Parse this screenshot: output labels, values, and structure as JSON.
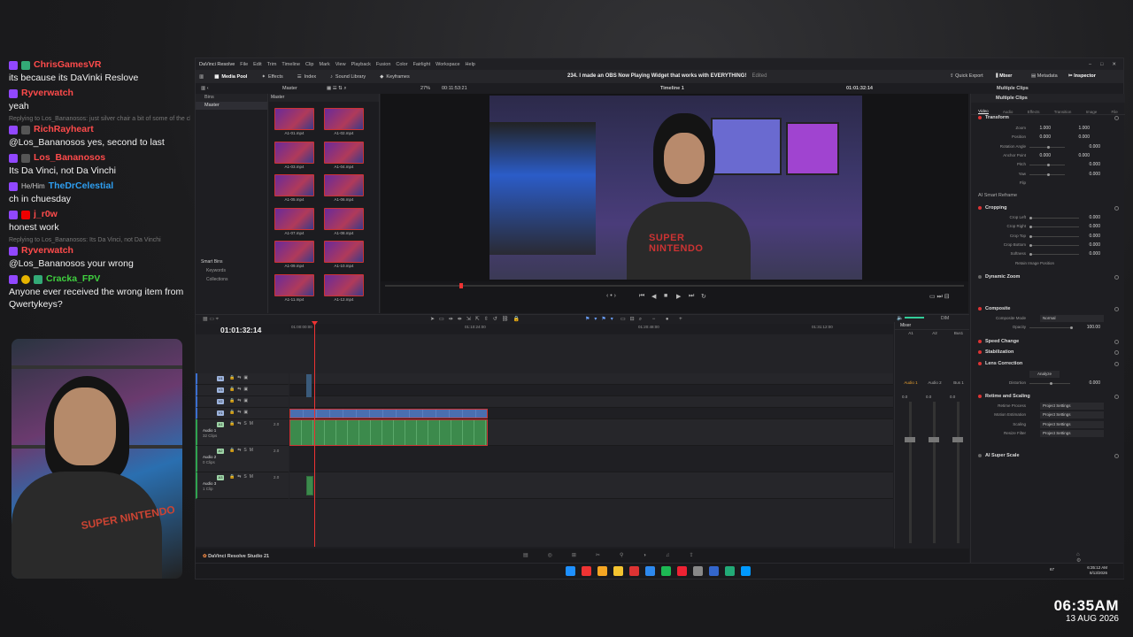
{
  "chat": [
    {
      "user": "ChrisGamesVR",
      "color": "#ff4b4b",
      "badges": [
        "sh"
      ],
      "text": "its because its DaVinki Reslove"
    },
    {
      "user": "Ryverwatch",
      "color": "#ff4b4b",
      "badges": [],
      "text": "yeah"
    },
    {
      "user": "RichRayheart",
      "color": "#ff4b4b",
      "badges": [
        "gr"
      ],
      "reply": "Replying to Los_Bananosos: just silver chair a bit of some of the chronicles of narnia books?",
      "text": "@Los_Bananosos yes, second to last"
    },
    {
      "user": "Los_Bananosos",
      "color": "#ff4b4b",
      "badges": [
        "gr"
      ],
      "text": "Its Da Vinci, not Da Vinchi"
    },
    {
      "user": "TheDrCelestial",
      "color": "#2e9ef0",
      "pronouns": "He/Him",
      "badges": [],
      "text": "ch in chuesday"
    },
    {
      "user": "j_r0w",
      "color": "#ff4b4b",
      "badges": [
        "yt"
      ],
      "text": "honest work"
    },
    {
      "user": "Ryverwatch",
      "color": "#ff4b4b",
      "badges": [],
      "reply": "Replying to Los_Bananosos: Its Da Vinci, not Da Vinchi",
      "text": "@Los_Bananosos your wrong"
    },
    {
      "user": "Cracka_FPV",
      "color": "#3fd13f",
      "badges": [
        "cr",
        "sh"
      ],
      "text": "Anyone ever received the wrong item from Qwertykeys?"
    }
  ],
  "overlay_clock": {
    "time": "06:35AM",
    "date": "13 AUG 2026"
  },
  "resolve": {
    "menu": [
      "DaVinci Resolve",
      "File",
      "Edit",
      "Trim",
      "Timeline",
      "Clip",
      "Mark",
      "View",
      "Playback",
      "Fusion",
      "Color",
      "Fairlight",
      "Workspace",
      "Help"
    ],
    "toolbar": {
      "media_pool": "Media Pool",
      "effects": "Effects",
      "index": "Index",
      "sound_library": "Sound Library",
      "keyframes": "Keyframes",
      "project_title": "234. I made an OBS Now Playing Widget that works with EVERYTHING!",
      "edited": "Edited",
      "quick_export": "Quick Export",
      "mixer": "Mixer",
      "metadata": "Metadata",
      "inspector": "Inspector"
    },
    "subbar": {
      "master": "Master",
      "zoom": "27%",
      "duration": "00:11:53:21",
      "timeline_name": "Timeline 1",
      "timecode": "01:01:32:14",
      "multiple_clips": "Multiple Clips"
    },
    "bins": {
      "header": "Bins",
      "master": "Master",
      "smart_bins": "Smart Bins",
      "keywords": "Keywords",
      "collections": "Collections"
    },
    "pool_header": "Master",
    "clips": [
      "A1-01.mp4",
      "A1-02.mp4",
      "A1-03.mp4",
      "A1-04.mp4",
      "A1-05.mp4",
      "A1-06.mp4",
      "A1-07.mp4",
      "A1-08.mp4",
      "A1-09.mp4",
      "A1-10.mp4",
      "A1-11.mp4",
      "A1-12.mp4"
    ],
    "video_shirt_text": "SUPER NINTENDO",
    "inspector": {
      "tabs": [
        "Video",
        "Audio",
        "Effects",
        "Transition",
        "Image",
        "File"
      ],
      "transform": {
        "title": "Transform",
        "params": [
          {
            "label": "Zoom",
            "x": "1.000",
            "y": "1.000"
          },
          {
            "label": "Position",
            "x": "0.000",
            "y": "0.000"
          },
          {
            "label": "Rotation Angle",
            "v": "0.000"
          },
          {
            "label": "Anchor Point",
            "x": "0.000",
            "y": "0.000"
          },
          {
            "label": "Pitch",
            "v": "0.000"
          },
          {
            "label": "Yaw",
            "v": "0.000"
          },
          {
            "label": "Flip",
            "v": ""
          }
        ]
      },
      "smart_reframe": "AI Smart Reframe",
      "cropping": {
        "title": "Cropping",
        "params": [
          {
            "label": "Crop Left",
            "v": "0.000"
          },
          {
            "label": "Crop Right",
            "v": "0.000"
          },
          {
            "label": "Crop Top",
            "v": "0.000"
          },
          {
            "label": "Crop Bottom",
            "v": "0.000"
          },
          {
            "label": "Softness",
            "v": "0.000"
          }
        ],
        "retain": "Retain Image Position"
      },
      "dynamic_zoom": "Dynamic Zoom",
      "composite": {
        "title": "Composite",
        "mode_label": "Composite Mode",
        "mode": "Normal",
        "opacity_label": "Opacity",
        "opacity": "100.00"
      },
      "speed_change": "Speed Change",
      "stabilization": "Stabilization",
      "lens": {
        "title": "Lens Correction",
        "analyze": "Analyze",
        "distortion_label": "Distortion",
        "distortion": "0.000"
      },
      "retime": {
        "title": "Retime and Scaling",
        "params": [
          {
            "label": "Retime Process",
            "v": "Project Settings"
          },
          {
            "label": "Motion Estimation",
            "v": "Project Settings"
          },
          {
            "label": "Scaling",
            "v": "Project Settings"
          },
          {
            "label": "Resize Filter",
            "v": "Project Settings"
          }
        ]
      },
      "super_scale": "AI Super Scale"
    },
    "timeline": {
      "timecode": "01:01:32:14",
      "ruler": [
        "01:00:00:00",
        "01:10:24:00",
        "01:20:48:00",
        "01:31:12:00"
      ],
      "tracks": [
        {
          "tag": "V4",
          "kind": "v"
        },
        {
          "tag": "V3",
          "kind": "v"
        },
        {
          "tag": "V2",
          "kind": "v"
        },
        {
          "tag": "V1",
          "kind": "v"
        },
        {
          "tag": "A1",
          "kind": "a",
          "name": "Audio 1",
          "sub": "32 Clips",
          "vol": "2.0"
        },
        {
          "tag": "A2",
          "kind": "a",
          "name": "Audio 2",
          "sub": "0 Clips",
          "vol": "2.0"
        },
        {
          "tag": "A3",
          "kind": "a",
          "name": "Audio 3",
          "sub": "1 Clip",
          "vol": "2.0"
        }
      ]
    },
    "mixer": {
      "title": "Mixer",
      "channels": [
        "A1",
        "A2",
        "Bus1"
      ],
      "labels": [
        "Audio 1",
        "Audio 2",
        "Bus 1"
      ],
      "level": "0.0",
      "dim": "DIM"
    },
    "brand": "DaVinci Resolve Studio 21",
    "systray": {
      "num": "67",
      "time": "6:35:12 AM",
      "date": "8/13/2026"
    }
  }
}
